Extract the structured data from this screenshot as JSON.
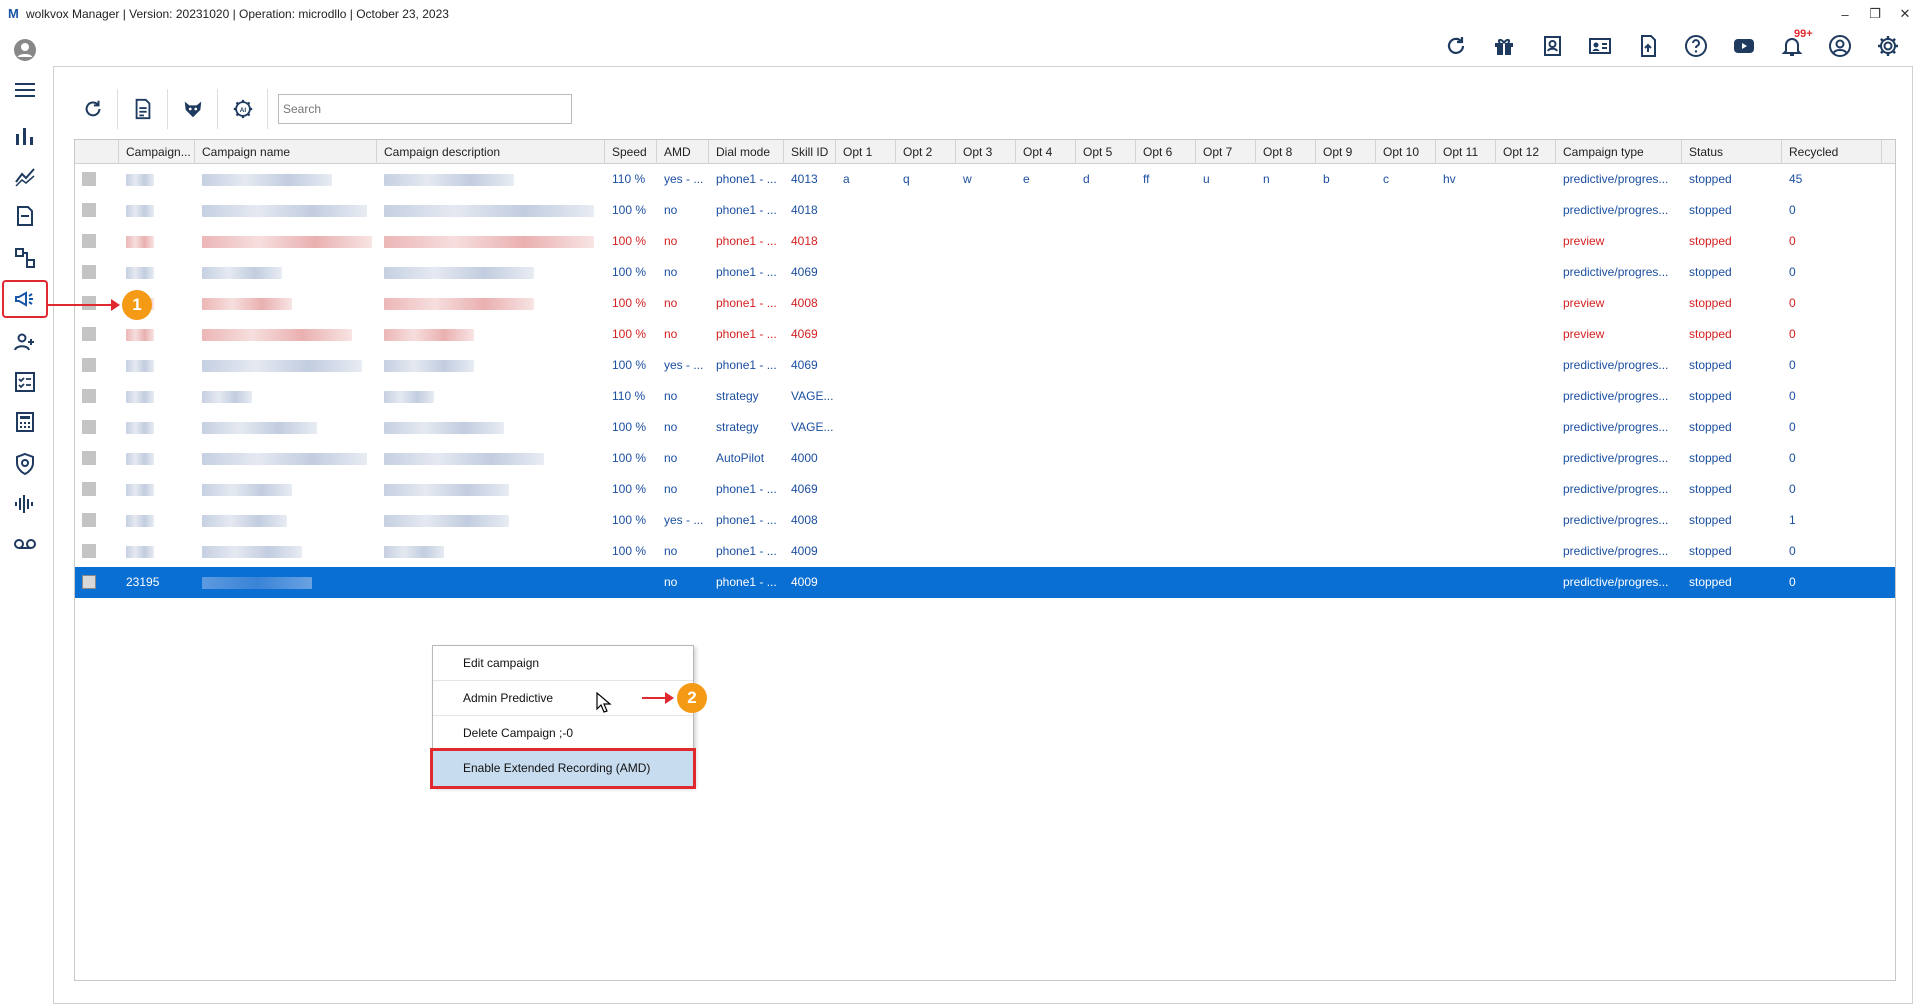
{
  "title": "wolkvox Manager  | Version: 20231020 |  Operation: microdllo | October 23, 2023",
  "logo_letter": "M",
  "notification_count": "99+",
  "search": {
    "placeholder": "Search"
  },
  "columns": [
    "",
    "Campaign...",
    "Campaign name",
    "Campaign description",
    "Speed",
    "AMD",
    "Dial mode",
    "Skill ID",
    "Opt 1",
    "Opt 2",
    "Opt 3",
    "Opt 4",
    "Opt 5",
    "Opt 6",
    "Opt 7",
    "Opt 8",
    "Opt 9",
    "Opt 10",
    "Opt 11",
    "Opt 12",
    "Campaign type",
    "Status",
    "Recycled"
  ],
  "rows": [
    {
      "color": "blue",
      "speed": "110 %",
      "amd": "yes - ...",
      "dial": "phone1 - ...",
      "skill": "4013",
      "opts": [
        "a",
        "q",
        "w",
        "e",
        "d",
        "ff",
        "u",
        "n",
        "b",
        "c",
        "hv",
        ""
      ],
      "type": "predictive/progres...",
      "status": "stopped",
      "recycled": "45"
    },
    {
      "color": "blue",
      "speed": "100 %",
      "amd": "no",
      "dial": "phone1 - ...",
      "skill": "4018",
      "opts": [],
      "type": "predictive/progres...",
      "status": "stopped",
      "recycled": "0"
    },
    {
      "color": "red",
      "speed": "100 %",
      "amd": "no",
      "dial": "phone1 - ...",
      "skill": "4018",
      "opts": [],
      "type": "preview",
      "status": "stopped",
      "recycled": "0"
    },
    {
      "color": "blue",
      "speed": "100 %",
      "amd": "no",
      "dial": "phone1 - ...",
      "skill": "4069",
      "opts": [],
      "type": "predictive/progres...",
      "status": "stopped",
      "recycled": "0"
    },
    {
      "color": "red",
      "speed": "100 %",
      "amd": "no",
      "dial": "phone1 - ...",
      "skill": "4008",
      "opts": [],
      "type": "preview",
      "status": "stopped",
      "recycled": "0"
    },
    {
      "color": "red",
      "speed": "100 %",
      "amd": "no",
      "dial": "phone1 - ...",
      "skill": "4069",
      "opts": [],
      "type": "preview",
      "status": "stopped",
      "recycled": "0"
    },
    {
      "color": "blue",
      "speed": "100 %",
      "amd": "yes - ...",
      "dial": "phone1 - ...",
      "skill": "4069",
      "opts": [],
      "type": "predictive/progres...",
      "status": "stopped",
      "recycled": "0"
    },
    {
      "color": "blue",
      "speed": "110 %",
      "amd": "no",
      "dial": "strategy",
      "skill": "VAGE...",
      "opts": [],
      "type": "predictive/progres...",
      "status": "stopped",
      "recycled": "0"
    },
    {
      "color": "blue",
      "speed": "100 %",
      "amd": "no",
      "dial": "strategy",
      "skill": "VAGE...",
      "opts": [],
      "type": "predictive/progres...",
      "status": "stopped",
      "recycled": "0"
    },
    {
      "color": "blue",
      "speed": "100 %",
      "amd": "no",
      "dial": "AutoPilot",
      "skill": "4000",
      "opts": [],
      "type": "predictive/progres...",
      "status": "stopped",
      "recycled": "0"
    },
    {
      "color": "blue",
      "speed": "100 %",
      "amd": "no",
      "dial": "phone1 - ...",
      "skill": "4069",
      "opts": [],
      "type": "predictive/progres...",
      "status": "stopped",
      "recycled": "0"
    },
    {
      "color": "blue",
      "speed": "100 %",
      "amd": "yes - ...",
      "dial": "phone1 - ...",
      "skill": "4008",
      "opts": [],
      "type": "predictive/progres...",
      "status": "stopped",
      "recycled": "1"
    },
    {
      "color": "blue",
      "speed": "100 %",
      "amd": "no",
      "dial": "phone1 - ...",
      "skill": "4009",
      "opts": [],
      "type": "predictive/progres...",
      "status": "stopped",
      "recycled": "0"
    }
  ],
  "selected_row": {
    "id": "23195",
    "speed": "",
    "amd": "no",
    "dial": "phone1 - ...",
    "skill": "4009",
    "type": "predictive/progres...",
    "status": "stopped",
    "recycled": "0"
  },
  "context_menu": {
    "items": [
      "Edit campaign",
      "Admin Predictive",
      "Delete Campaign ;-0",
      "Enable Extended Recording (AMD)"
    ]
  },
  "callouts": [
    "1",
    "2"
  ],
  "colors": {
    "blue_text": "#1c4fa0",
    "red_text": "#d42020",
    "selection": "#0a6fd2",
    "annotation": "#e0282f",
    "callout": "#f59a14"
  }
}
